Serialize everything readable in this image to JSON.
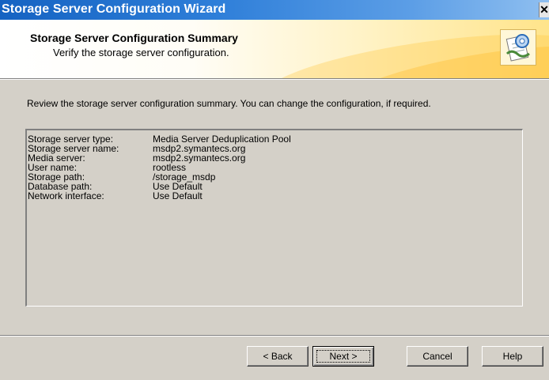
{
  "window": {
    "title": "Storage Server Configuration Wizard",
    "close_glyph": "✕"
  },
  "header": {
    "title": "Storage Server Configuration Summary",
    "subtitle": "Verify the storage server configuration.",
    "icon": "wizard-settings-icon"
  },
  "instructions": "Review the storage server configuration summary. You can change the configuration, if required.",
  "summary": {
    "rows": [
      {
        "label": "Storage server type:",
        "value": "Media Server Deduplication Pool"
      },
      {
        "label": "Storage server name:",
        "value": "msdp2.symantecs.org"
      },
      {
        "label": "Media server:",
        "value": "msdp2.symantecs.org"
      },
      {
        "label": "User name:",
        "value": "rootless"
      },
      {
        "label": "Storage path:",
        "value": "/storage_msdp"
      },
      {
        "label": "Database path:",
        "value": "Use Default"
      },
      {
        "label": "Network interface:",
        "value": "Use Default"
      }
    ]
  },
  "buttons": {
    "back": "< Back",
    "next": "Next >",
    "cancel": "Cancel",
    "help": "Help"
  },
  "colors": {
    "titlebar": "#2f7fd9",
    "dialog_bg": "#d4d0c8",
    "header_accent": "#ffe48a"
  }
}
